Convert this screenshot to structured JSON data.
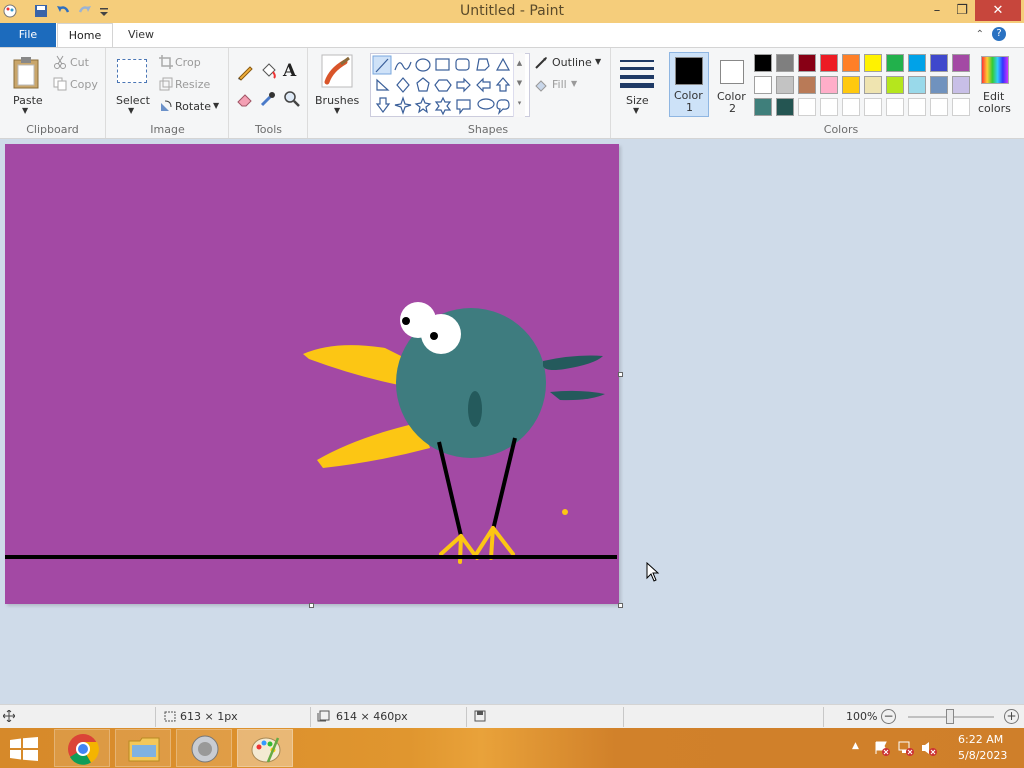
{
  "window": {
    "title": "Untitled - Paint",
    "minimize": "–",
    "restore": "❐",
    "close": "✕"
  },
  "tabs": {
    "file": "File",
    "home": "Home",
    "view": "View",
    "help": "?"
  },
  "clipboard": {
    "paste": "Paste",
    "cut": "Cut",
    "copy": "Copy",
    "group": "Clipboard"
  },
  "image": {
    "select": "Select",
    "crop": "Crop",
    "resize": "Resize",
    "rotate": "Rotate",
    "group": "Image"
  },
  "tools": {
    "group": "Tools",
    "text_icon": "A"
  },
  "brushes": {
    "label": "Brushes"
  },
  "shapes": {
    "outline": "Outline",
    "fill": "Fill",
    "group": "Shapes"
  },
  "size": {
    "label": "Size"
  },
  "colors": {
    "color1_label": "Color\n1",
    "color1_line1": "Color",
    "color1_line2": "1",
    "color2_line1": "Color",
    "color2_line2": "2",
    "edit_line1": "Edit",
    "edit_line2": "colors",
    "group": "Colors",
    "color1": "#000000",
    "color2": "#ffffff",
    "palette": [
      [
        "#000000",
        "#7f7f7f",
        "#880015",
        "#ed1c24",
        "#ff7f27",
        "#fff200",
        "#22b14c",
        "#00a2e8",
        "#3f48cc",
        "#a349a4"
      ],
      [
        "#ffffff",
        "#c3c3c3",
        "#b97a57",
        "#ffaec9",
        "#ffc90e",
        "#efe4b0",
        "#b5e61d",
        "#99d9ea",
        "#7092be",
        "#c8bfe7"
      ],
      [
        "#3f7f7b",
        "#245552",
        "#ffffff",
        "#ffffff",
        "#ffffff",
        "#ffffff",
        "#ffffff",
        "#ffffff",
        "#ffffff",
        "#ffffff"
      ]
    ]
  },
  "canvas": {
    "background": "#a349a4",
    "bird_body": "#3e7c7f",
    "beak": "#fcc614",
    "line": "#000000"
  },
  "status": {
    "selection_size": "613 × 1px",
    "image_size": "614 × 460px",
    "zoom": "100%"
  },
  "clock": {
    "time": "6:22 AM",
    "date": "5/8/2023"
  }
}
